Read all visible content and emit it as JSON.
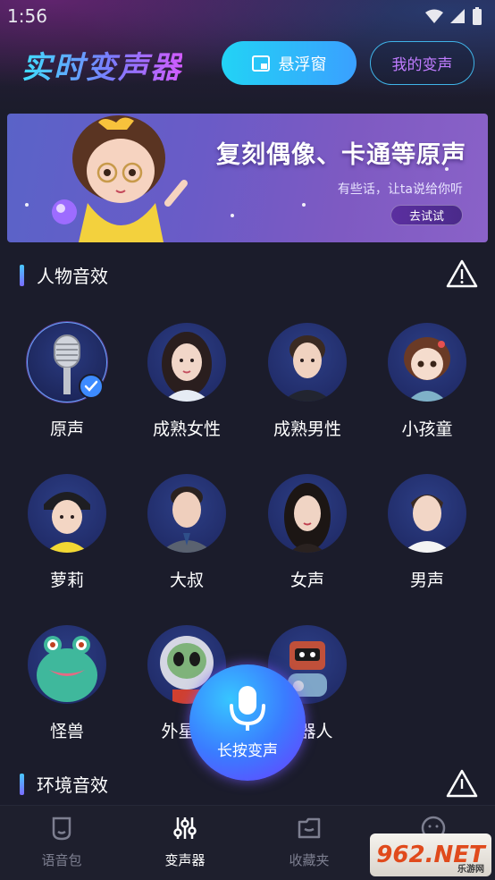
{
  "status_bar": {
    "time": "1:56"
  },
  "header": {
    "app_title": "实时变声器",
    "float_button_label": "悬浮窗",
    "my_voice_button_label": "我的变声"
  },
  "banner": {
    "headline": "复刻偶像、卡通等原声",
    "subtitle": "有些话，让ta说给你听",
    "button_label": "去试试"
  },
  "sections": {
    "character": {
      "title": "人物音效"
    },
    "environment": {
      "title": "环境音效"
    }
  },
  "voices": [
    {
      "label": "原声",
      "icon": "microphone-icon",
      "selected": true
    },
    {
      "label": "成熟女性",
      "icon": "woman-avatar"
    },
    {
      "label": "成熟男性",
      "icon": "man-avatar"
    },
    {
      "label": "小孩童",
      "icon": "child-avatar"
    },
    {
      "label": "萝莉",
      "icon": "girl-avatar"
    },
    {
      "label": "大叔",
      "icon": "uncle-avatar"
    },
    {
      "label": "女声",
      "icon": "female-avatar"
    },
    {
      "label": "男声",
      "icon": "male-avatar"
    },
    {
      "label": "怪兽",
      "icon": "monster-avatar"
    },
    {
      "label": "外星人",
      "icon": "alien-avatar"
    },
    {
      "label": "机器人",
      "icon": "robot-avatar"
    }
  ],
  "mic_button": {
    "label": "长按变声"
  },
  "tabbar": {
    "tabs": [
      {
        "label": "语音包",
        "icon": "voice-pack-icon",
        "active": false
      },
      {
        "label": "变声器",
        "icon": "equalizer-icon",
        "active": true
      },
      {
        "label": "收藏夹",
        "icon": "favorites-icon",
        "active": false
      },
      {
        "label": "",
        "icon": "profile-icon",
        "active": false
      }
    ]
  },
  "watermark": {
    "main": "962.NET",
    "sub": "乐游网"
  },
  "colors": {
    "background": "#1b1c2b",
    "accent_cyan": "#22d3f5",
    "accent_purple": "#c07cff",
    "selected_ring": "#6aa3ff"
  }
}
